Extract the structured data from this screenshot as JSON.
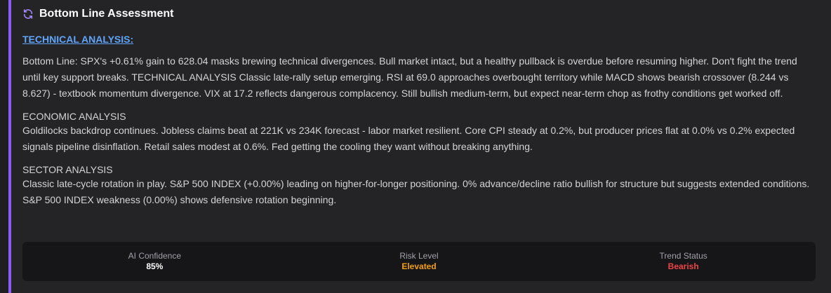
{
  "header": {
    "title": "Bottom Line Assessment",
    "icon": "refresh-icon",
    "accent_color": "#8b5cf6"
  },
  "technical": {
    "heading": "TECHNICAL ANALYSIS:",
    "body": "Bottom Line: SPX's +0.61% gain to 628.04 masks brewing technical divergences. Bull market intact, but a healthy pullback is overdue before resuming higher. Don't fight the trend until key support breaks. TECHNICAL ANALYSIS Classic late-rally setup emerging. RSI at 69.0 approaches overbought territory while MACD shows bearish crossover (8.244 vs 8.627) - textbook momentum divergence. VIX at 17.2 reflects dangerous complacency. Still bullish medium-term, but expect near-term chop as frothy conditions get worked off."
  },
  "economic": {
    "heading": "ECONOMIC ANALYSIS",
    "body": "Goldilocks backdrop continues. Jobless claims beat at 221K vs 234K forecast - labor market resilient. Core CPI steady at 0.2%, but producer prices flat at 0.0% vs 0.2% expected signals pipeline disinflation. Retail sales modest at 0.6%. Fed getting the cooling they want without breaking anything."
  },
  "sector": {
    "heading": "SECTOR ANALYSIS",
    "body": "Classic late-cycle rotation in play. S&P 500 INDEX (+0.00%) leading on higher-for-longer positioning. 0% advance/decline ratio bullish for structure but suggests extended conditions. S&P 500 INDEX weakness (0.00%) shows defensive rotation beginning."
  },
  "stats": [
    {
      "label": "AI Confidence",
      "value": "85%",
      "color": "#ffffff"
    },
    {
      "label": "Risk Level",
      "value": "Elevated",
      "color": "#f59e0b"
    },
    {
      "label": "Trend Status",
      "value": "Bearish",
      "color": "#ef4444"
    }
  ]
}
